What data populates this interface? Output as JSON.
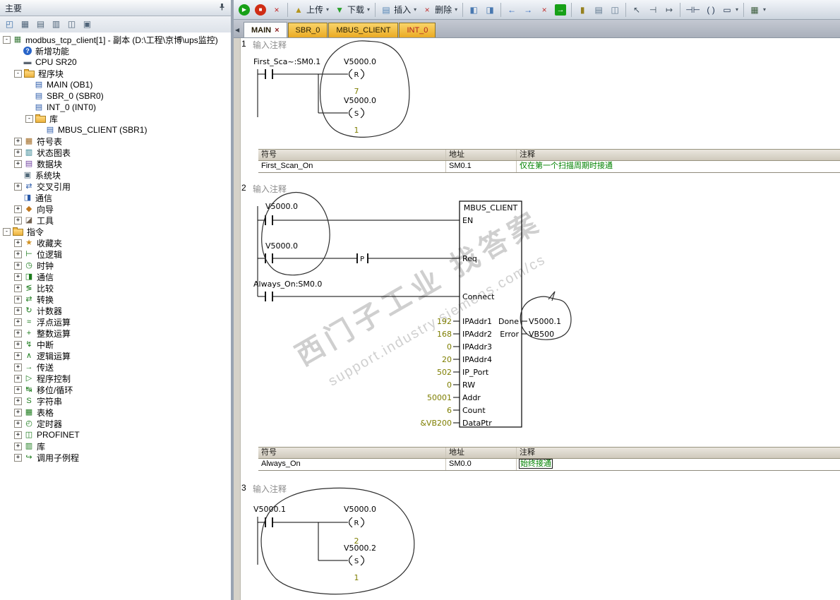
{
  "left_panel": {
    "title": "主要",
    "toolbar_icons": [
      {
        "name": "view-project-icon",
        "glyph": "◰",
        "color": "#3a6ea8"
      },
      {
        "name": "view-symbols-icon",
        "glyph": "▦",
        "color": "#50657a"
      },
      {
        "name": "view-status-icon",
        "glyph": "▤",
        "color": "#50657a"
      },
      {
        "name": "view-data-icon",
        "glyph": "▥",
        "color": "#50657a"
      },
      {
        "name": "view-chart-icon",
        "glyph": "◫",
        "color": "#50657a"
      },
      {
        "name": "view-output-icon",
        "glyph": "▣",
        "color": "#50657a"
      }
    ],
    "tree": [
      {
        "label": "modbus_tcp_client[1] - 副本 (D:\\工程\\京博\\ups监控)",
        "depth": 0,
        "expand": "-",
        "icon": "plc-project",
        "glyph": "▦",
        "color": "#3a7a3a"
      },
      {
        "label": "新增功能",
        "depth": 1,
        "icon": "new-features",
        "glyph": "?",
        "color": "#ffffff",
        "bg": "#2864c8"
      },
      {
        "label": "CPU SR20",
        "depth": 1,
        "icon": "cpu",
        "glyph": "▬",
        "color": "#5a6470"
      },
      {
        "label": "程序块",
        "depth": 1,
        "expand": "-",
        "icon": "folder-program"
      },
      {
        "label": "MAIN (OB1)",
        "depth": 2,
        "icon": "program-block",
        "glyph": "▤",
        "color": "#2858a8"
      },
      {
        "label": "SBR_0 (SBR0)",
        "depth": 2,
        "icon": "program-block",
        "glyph": "▤",
        "color": "#2858a8"
      },
      {
        "label": "INT_0 (INT0)",
        "depth": 2,
        "icon": "program-block",
        "glyph": "▤",
        "color": "#2858a8"
      },
      {
        "label": "库",
        "depth": 2,
        "expand": "-",
        "icon": "folder-library"
      },
      {
        "label": "MBUS_CLIENT (SBR1)",
        "depth": 3,
        "icon": "program-block",
        "glyph": "▤",
        "color": "#2858a8"
      },
      {
        "label": "符号表",
        "depth": 1,
        "expand": "+",
        "icon": "symbol-table",
        "glyph": "▦",
        "color": "#a06820"
      },
      {
        "label": "状态图表",
        "depth": 1,
        "expand": "+",
        "icon": "status-chart",
        "glyph": "▥",
        "color": "#207888"
      },
      {
        "label": "数据块",
        "depth": 1,
        "expand": "+",
        "icon": "data-block",
        "glyph": "▤",
        "color": "#7040a0"
      },
      {
        "label": "系统块",
        "depth": 1,
        "icon": "system-block",
        "glyph": "▣",
        "color": "#506878"
      },
      {
        "label": "交叉引用",
        "depth": 1,
        "expand": "+",
        "icon": "cross-reference",
        "glyph": "⇄",
        "color": "#2858a8"
      },
      {
        "label": "通信",
        "depth": 1,
        "icon": "communication",
        "glyph": "◨",
        "color": "#2858a8"
      },
      {
        "label": "向导",
        "depth": 1,
        "expand": "+",
        "icon": "wizard",
        "glyph": "◆",
        "color": "#c07820"
      },
      {
        "label": "工具",
        "depth": 1,
        "expand": "+",
        "icon": "tools",
        "glyph": "◪",
        "color": "#706050"
      },
      {
        "label": "指令",
        "depth": 0,
        "expand": "-",
        "icon": "folder-instructions"
      },
      {
        "label": "收藏夹",
        "depth": 1,
        "expand": "+",
        "icon": "favorites",
        "glyph": "★",
        "color": "#d09020"
      },
      {
        "label": "位逻辑",
        "depth": 1,
        "expand": "+",
        "icon": "bit-logic",
        "glyph": "⊢",
        "color": "#1a7a1a"
      },
      {
        "label": "时钟",
        "depth": 1,
        "expand": "+",
        "icon": "clock",
        "glyph": "◷",
        "color": "#1a7a1a"
      },
      {
        "label": "通信",
        "depth": 1,
        "expand": "+",
        "icon": "comm-instructions",
        "glyph": "◨",
        "color": "#1a7a1a"
      },
      {
        "label": "比较",
        "depth": 1,
        "expand": "+",
        "icon": "compare",
        "glyph": "≶",
        "color": "#1a7a1a"
      },
      {
        "label": "转换",
        "depth": 1,
        "expand": "+",
        "icon": "convert",
        "glyph": "⇄",
        "color": "#1a7a1a"
      },
      {
        "label": "计数器",
        "depth": 1,
        "expand": "+",
        "icon": "counter",
        "glyph": "↻",
        "color": "#1a7a1a"
      },
      {
        "label": "浮点运算",
        "depth": 1,
        "expand": "+",
        "icon": "float-math",
        "glyph": "≈",
        "color": "#1a7a1a"
      },
      {
        "label": "整数运算",
        "depth": 1,
        "expand": "+",
        "icon": "integer-math",
        "glyph": "+",
        "color": "#1a7a1a"
      },
      {
        "label": "中断",
        "depth": 1,
        "expand": "+",
        "icon": "interrupt",
        "glyph": "↯",
        "color": "#1a7a1a"
      },
      {
        "label": "逻辑运算",
        "depth": 1,
        "expand": "+",
        "icon": "logic-operations",
        "glyph": "∧",
        "color": "#1a7a1a"
      },
      {
        "label": "传送",
        "depth": 1,
        "expand": "+",
        "icon": "move",
        "glyph": "→",
        "color": "#1a7a1a"
      },
      {
        "label": "程序控制",
        "depth": 1,
        "expand": "+",
        "icon": "program-control",
        "glyph": "▷",
        "color": "#1a7a1a"
      },
      {
        "label": "移位/循环",
        "depth": 1,
        "expand": "+",
        "icon": "shift-rotate",
        "glyph": "↹",
        "color": "#1a7a1a"
      },
      {
        "label": "字符串",
        "depth": 1,
        "expand": "+",
        "icon": "string",
        "glyph": "S",
        "color": "#1a7a1a"
      },
      {
        "label": "表格",
        "depth": 1,
        "expand": "+",
        "icon": "table",
        "glyph": "▦",
        "color": "#1a7a1a"
      },
      {
        "label": "定时器",
        "depth": 1,
        "expand": "+",
        "icon": "timer",
        "glyph": "◴",
        "color": "#1a7a1a"
      },
      {
        "label": "PROFINET",
        "depth": 1,
        "expand": "+",
        "icon": "profinet",
        "glyph": "◫",
        "color": "#1a7a1a"
      },
      {
        "label": "库",
        "depth": 1,
        "expand": "+",
        "icon": "library",
        "glyph": "▥",
        "color": "#1a7a1a"
      },
      {
        "label": "调用子例程",
        "depth": 1,
        "expand": "+",
        "icon": "call-subroutine",
        "glyph": "↪",
        "color": "#1a7a1a"
      }
    ]
  },
  "toolbar": {
    "dd_glyph": "▾",
    "items": [
      {
        "name": "run-button",
        "kind": "circle",
        "glyph": "▶",
        "bg": "#17a017"
      },
      {
        "name": "stop-button",
        "kind": "circle",
        "glyph": "■",
        "bg": "#cf2c14"
      },
      {
        "name": "compile-button",
        "kind": "plain",
        "glyph": "×",
        "color": "#c02020"
      },
      {
        "kind": "sep"
      },
      {
        "name": "upload-button",
        "kind": "labeled",
        "glyph": "▲",
        "color": "#b5951c",
        "label": "上传",
        "dd": true
      },
      {
        "name": "download-button",
        "kind": "labeled",
        "glyph": "▼",
        "color": "#2aa02a",
        "label": "下载",
        "dd": true
      },
      {
        "kind": "sep"
      },
      {
        "name": "insert-button",
        "kind": "labeled",
        "glyph": "▤",
        "color": "#5585b5",
        "label": "插入",
        "dd": true
      },
      {
        "name": "delete-button",
        "kind": "labeled",
        "glyph": "×",
        "color": "#c03030",
        "label": "删除",
        "dd": true
      },
      {
        "kind": "sep"
      },
      {
        "name": "bookmark-button",
        "kind": "plain",
        "glyph": "◧",
        "color": "#4878b0"
      },
      {
        "name": "next-bookmark-button",
        "kind": "plain",
        "glyph": "◨",
        "color": "#4878b0"
      },
      {
        "kind": "sep"
      },
      {
        "name": "previous-button",
        "kind": "plain",
        "glyph": "←",
        "color": "#3068c0"
      },
      {
        "name": "next-button",
        "kind": "plain",
        "glyph": "→",
        "color": "#3068c0"
      },
      {
        "name": "clear-button",
        "kind": "plain",
        "glyph": "×",
        "color": "#c03030"
      },
      {
        "name": "goto-button",
        "kind": "square",
        "glyph": "→",
        "bg": "#17a017"
      },
      {
        "kind": "sep"
      },
      {
        "name": "protect-button",
        "kind": "plain",
        "glyph": "▮",
        "color": "#96801e"
      },
      {
        "name": "properties-button",
        "kind": "plain",
        "glyph": "▤",
        "color": "#60788e"
      },
      {
        "name": "new-window-button",
        "kind": "plain",
        "glyph": "◫",
        "color": "#60788e"
      },
      {
        "kind": "sep"
      },
      {
        "name": "select-tool-button",
        "kind": "plain",
        "glyph": "↖",
        "color": "#43525f"
      },
      {
        "name": "address-tool-button",
        "kind": "plain",
        "glyph": "⊣",
        "color": "#43525f"
      },
      {
        "name": "jump-tool-button",
        "kind": "plain",
        "glyph": "↦",
        "color": "#43525f"
      },
      {
        "kind": "sep"
      },
      {
        "name": "insert-contact-button",
        "kind": "plain",
        "glyph": "⊣⊢",
        "color": "#233550"
      },
      {
        "name": "insert-coil-button",
        "kind": "plain",
        "glyph": "( )",
        "color": "#233550"
      },
      {
        "name": "insert-box-button",
        "kind": "plain",
        "glyph": "▭",
        "color": "#233550",
        "dd": true
      },
      {
        "kind": "sep"
      },
      {
        "name": "ladder-view-button",
        "kind": "plain",
        "glyph": "▦",
        "color": "#3f5f3f",
        "dd": true
      }
    ]
  },
  "tabs_bar": {
    "nav_icon": "◀",
    "tabs": [
      {
        "label": "MAIN",
        "active": true,
        "close": "×"
      },
      {
        "label": "SBR_0"
      },
      {
        "label": "MBUS_CLIENT"
      },
      {
        "label": "INT_0",
        "color": "#b02020"
      }
    ]
  },
  "editor": {
    "networks": [
      {
        "number": "1",
        "comment": "输入注释"
      },
      {
        "number": "2",
        "comment": "输入注释"
      },
      {
        "number": "3",
        "comment": "输入注释"
      }
    ],
    "net1": {
      "contact_label": "First_Sca~:SM0.1",
      "coil1_label": "V5000.0",
      "coil1_type": "R",
      "coil1_value": "7",
      "coil2_label": "V5000.0",
      "coil2_type": "S",
      "coil2_value": "1"
    },
    "net2": {
      "box_title": "MBUS_CLIENT",
      "contact1_label": "V5000.0",
      "contact2_label": "V5000.0",
      "edge_label": "P",
      "contact3_label": "Always_On:SM0.0",
      "inputs": [
        {
          "pin": "EN",
          "value": ""
        },
        {
          "pin": "Req",
          "value": ""
        },
        {
          "pin": "Connect",
          "value": ""
        },
        {
          "pin": "IPAddr1",
          "value": "192"
        },
        {
          "pin": "IPAddr2",
          "value": "168"
        },
        {
          "pin": "IPAddr3",
          "value": "0"
        },
        {
          "pin": "IPAddr4",
          "value": "20"
        },
        {
          "pin": "IP_Port",
          "value": "502"
        },
        {
          "pin": "RW",
          "value": "0"
        },
        {
          "pin": "Addr",
          "value": "50001"
        },
        {
          "pin": "Count",
          "value": "6"
        },
        {
          "pin": "DataPtr",
          "value": "&VB200"
        }
      ],
      "outputs": [
        {
          "pin": "Done",
          "value": "V5000.1"
        },
        {
          "pin": "Error",
          "value": "VB500"
        }
      ]
    },
    "net3": {
      "contact_label": "V5000.1",
      "coil1_label": "V5000.0",
      "coil1_type": "R",
      "coil1_value": "2",
      "coil2_label": "V5000.2",
      "coil2_type": "S",
      "coil2_value": "1"
    },
    "tables": [
      {
        "headers": [
          "符号",
          "地址",
          "注释"
        ],
        "rows": [
          [
            "First_Scan_On",
            "SM0.1",
            "仅在第一个扫描周期时接通"
          ]
        ]
      },
      {
        "headers": [
          "符号",
          "地址",
          "注释"
        ],
        "rows": [
          [
            "Always_On",
            "SM0.0",
            "始终接通"
          ]
        ]
      }
    ],
    "watermark": {
      "line1": "西门子工业 找答案",
      "line2": "support.industry.siemens.com/cs"
    }
  }
}
